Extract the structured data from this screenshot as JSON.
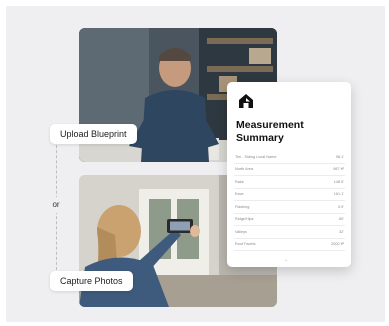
{
  "steps": {
    "upload_label": "Upload Blueprint",
    "or_label": "or",
    "capture_label": "Capture Photos"
  },
  "card": {
    "title": "Measurement Summary",
    "logo_icon": "house-logo-icon",
    "rows": [
      {
        "label": "Tim - Siding Local Name",
        "value": "98.1'"
      },
      {
        "label": "North Area",
        "value": "987 ft²"
      },
      {
        "label": "Rake",
        "value": "148.5'"
      },
      {
        "label": "Eave",
        "value": "161.1'"
      },
      {
        "label": "Flashing",
        "value": "0.9'"
      },
      {
        "label": "Ridge/Hips",
        "value": "60'"
      },
      {
        "label": "Valleys",
        "value": "32'"
      },
      {
        "label": "Roof Facets",
        "value": "2000 ft²"
      }
    ],
    "more_icon": "chevron-down-icon"
  },
  "colors": {
    "background": "#efeff1",
    "card": "#ffffff",
    "text": "#111111"
  }
}
